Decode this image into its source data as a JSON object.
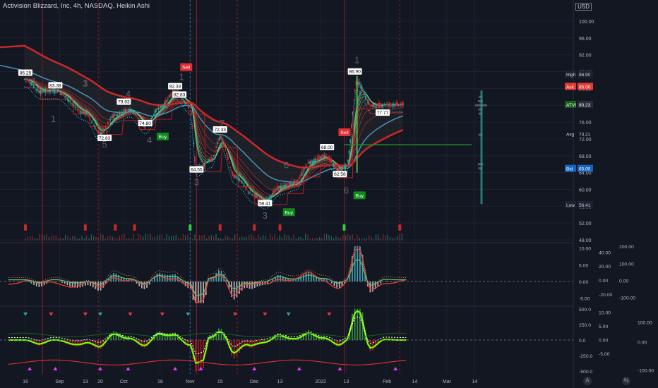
{
  "header": {
    "title": "Activision Blizzard, Inc, 4h, NASDAQ, Heikin Ashi",
    "currency": "USD"
  },
  "colors": {
    "background": "#131722",
    "grid": "#1e2230",
    "price_axis_text": "#b2b5be",
    "sell": "#e52e33",
    "buy": "#108a1c",
    "ema_slow": "#c62828",
    "ema_mid": "#4a90b8",
    "bull": "#26a69a",
    "bear": "#ef5350",
    "green_bright": "#4caf50",
    "magenta": "#e040fb"
  },
  "chart_data": [
    {
      "type": "candlestick",
      "title": "Activision Blizzard, Inc, 4h, NASDAQ, Heikin Ashi",
      "y_ticks": [
        "100.00",
        "96.00",
        "92.00",
        "88.00",
        "84.00",
        "80.00",
        "76.00",
        "72.00",
        "68.00",
        "64.00",
        "60.00",
        "56.00",
        "52.00",
        "48.00"
      ],
      "ylim": [
        48,
        100
      ],
      "x_ticks": [
        "16",
        "Sep",
        "13",
        "20",
        "Oct",
        "18",
        "Nov",
        "15",
        "Dec",
        "13",
        "2022",
        "13",
        "Feb",
        "14",
        "Mar",
        "14"
      ],
      "price_path": [
        {
          "x": "Aug 16",
          "y": 86.2
        },
        {
          "x": "Aug 23",
          "y": 83.3
        },
        {
          "x": "Aug 30",
          "y": 83.4
        },
        {
          "x": "Sep 13",
          "y": 78.2
        },
        {
          "x": "Sep 20",
          "y": 73.3
        },
        {
          "x": "Sep 27",
          "y": 77.7
        },
        {
          "x": "Oct 4",
          "y": 79.0
        },
        {
          "x": "Oct 11",
          "y": 75.0
        },
        {
          "x": "Oct 18",
          "y": 79.5
        },
        {
          "x": "Oct 25",
          "y": 83.3
        },
        {
          "x": "Nov 1",
          "y": 79.8
        },
        {
          "x": "Nov 4",
          "y": 64.9
        },
        {
          "x": "Nov 11",
          "y": 67.0
        },
        {
          "x": "Nov 15",
          "y": 72.3
        },
        {
          "x": "Nov 22",
          "y": 63.0
        },
        {
          "x": "Dec 1",
          "y": 58.5
        },
        {
          "x": "Dec 6",
          "y": 57.1
        },
        {
          "x": "Dec 13",
          "y": 60.5
        },
        {
          "x": "Dec 20",
          "y": 61.5
        },
        {
          "x": "Dec 27",
          "y": 66.5
        },
        {
          "x": "Jan 3",
          "y": 68.0
        },
        {
          "x": "Jan 10",
          "y": 64.5
        },
        {
          "x": "Jan 13",
          "y": 65.5
        },
        {
          "x": "Jan 18",
          "y": 85.5
        },
        {
          "x": "Jan 25",
          "y": 79.8
        },
        {
          "x": "Feb 1",
          "y": 80.2
        },
        {
          "x": "Feb 9",
          "y": 80.2
        }
      ],
      "price_labels": [
        "86.25",
        "83.38",
        "82.33",
        "79.93",
        "74.80",
        "72.83",
        "82.83",
        "64.55",
        "72.33",
        "68.00",
        "56.41",
        "62.58",
        "86.90",
        "77.77"
      ],
      "wave_labels": [
        "1",
        "3",
        "1",
        "4",
        "5",
        "4",
        "1",
        "3",
        "7",
        "3",
        "6",
        "1",
        "6",
        "1"
      ],
      "signals": [
        {
          "label": "Sell",
          "x": "Oct 29"
        },
        {
          "label": "Buy",
          "x": "Oct 19"
        },
        {
          "label": "Buy",
          "x": "Dec 17"
        },
        {
          "label": "Sell",
          "x": "Jan 12"
        },
        {
          "label": "Buy",
          "x": "Jan 18"
        }
      ],
      "price_axis_badges": [
        {
          "label": "High",
          "value": "86.90"
        },
        {
          "label": "Ask",
          "value": "85.00"
        },
        {
          "label": "ATVI",
          "value": "80.23"
        },
        {
          "label": "Avg",
          "value": "73.21"
        },
        {
          "label": "Bid",
          "value": "65.00"
        },
        {
          "label": "Low",
          "value": "56.41"
        }
      ]
    },
    {
      "type": "line",
      "title": "",
      "y_ticks_inner": [
        "10.00",
        "5.00",
        "0.00",
        "-5.00"
      ],
      "y_ticks_mid": [
        "40.00",
        "20.00",
        "0.00",
        "-20.00"
      ],
      "y_ticks_outer": [
        "200.00",
        "100.00",
        "0.00",
        "-100.00"
      ],
      "ylim": [
        -7,
        11
      ]
    },
    {
      "type": "area",
      "title": "",
      "y_ticks_inner": [
        "500.0",
        "250.0",
        "0.0",
        "-250.0",
        "-500.0"
      ],
      "y_ticks_mid": [
        "10.00",
        "5.00",
        "0.00",
        "-5.00"
      ],
      "y_ticks_outer": [
        "100.00",
        "0.00",
        "-100.00"
      ],
      "ylim": [
        -520,
        520
      ]
    }
  ],
  "footer": {
    "zoom_buttons": [
      "A",
      "@",
      "%"
    ]
  }
}
